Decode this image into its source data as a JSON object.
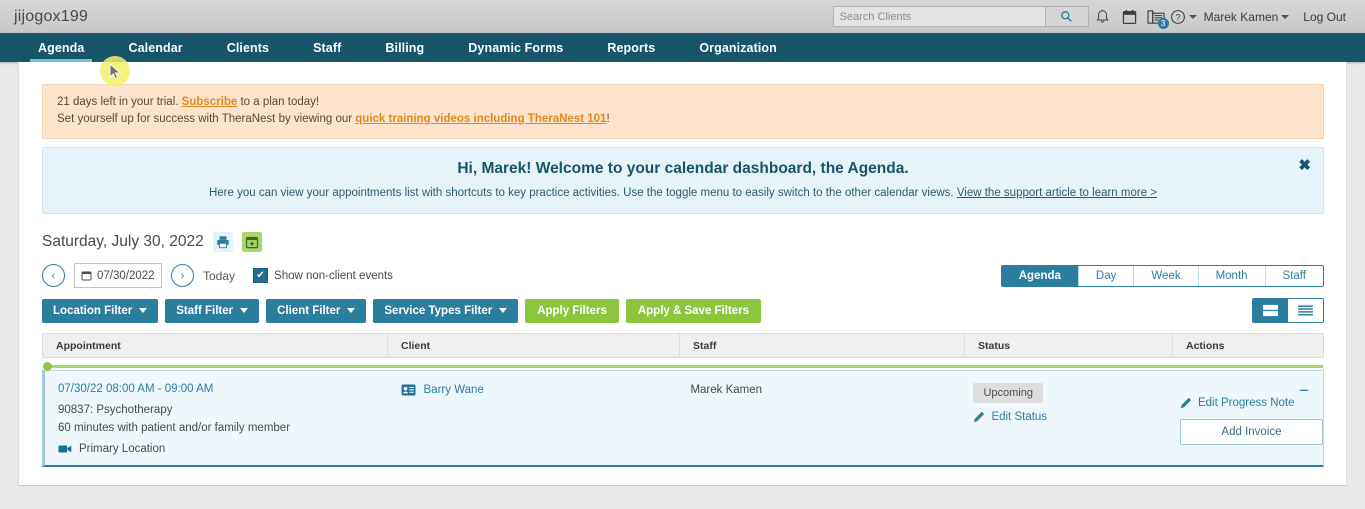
{
  "topbar": {
    "brand": "jijogox199",
    "search_placeholder": "Search Clients",
    "search_value": "",
    "search_icon": "search-icon",
    "bell_icon": "bell-icon",
    "calendar_icon": "calendar-icon",
    "fax_icon": "fax-icon",
    "fax_badge": "3",
    "help_icon": "question-circle-icon",
    "user_name": "Marek Kamen",
    "logout": "Log Out"
  },
  "nav": {
    "items": [
      {
        "label": "Agenda",
        "active": true
      },
      {
        "label": "Calendar",
        "active": false
      },
      {
        "label": "Clients",
        "active": false
      },
      {
        "label": "Staff",
        "active": false
      },
      {
        "label": "Billing",
        "active": false
      },
      {
        "label": "Dynamic Forms",
        "active": false
      },
      {
        "label": "Reports",
        "active": false
      },
      {
        "label": "Organization",
        "active": false
      }
    ]
  },
  "trial_banner": {
    "line1_pre": "21 days left in your trial. ",
    "line1_link": "Subscribe",
    "line1_post": " to a plan today!",
    "line2_pre": "Set yourself up for success with TheraNest by viewing our ",
    "line2_link": "quick training videos including TheraNest 101",
    "line2_post": "!"
  },
  "welcome": {
    "title": "Hi, Marek! Welcome to your calendar dashboard, the Agenda.",
    "body_pre": "Here you can view your appointments list with shortcuts to key practice activities. Use the toggle menu to easily switch to the other calendar views. ",
    "body_link": "View the support article to learn more >",
    "close_icon": "close-icon",
    "close_glyph": "✖"
  },
  "date_row": {
    "title": "Saturday, July 30, 2022",
    "print_icon": "print-icon",
    "add_calendar_icon": "add-calendar-icon"
  },
  "controls": {
    "prev_glyph": "‹",
    "next_glyph": "›",
    "date_value": "07/30/2022",
    "date_icon": "calendar-icon",
    "today_label": "Today",
    "checkbox_checked": true,
    "checkbox_glyph": "✔",
    "checkbox_label": "Show non-client events",
    "views": [
      {
        "label": "Agenda",
        "selected": true
      },
      {
        "label": "Day",
        "selected": false
      },
      {
        "label": "Week",
        "selected": false
      },
      {
        "label": "Month",
        "selected": false
      },
      {
        "label": "Staff",
        "selected": false
      }
    ]
  },
  "filters": {
    "dropdowns": [
      {
        "label": "Location Filter"
      },
      {
        "label": "Staff Filter"
      },
      {
        "label": "Client Filter"
      },
      {
        "label": "Service Types Filter"
      }
    ],
    "apply_label": "Apply Filters",
    "apply_save_label": "Apply & Save Filters",
    "list_view_icon": "card-view-icon",
    "compact_view_icon": "list-view-icon"
  },
  "table": {
    "columns": [
      "Appointment",
      "Client",
      "Staff",
      "Status",
      "Actions"
    ],
    "rows": [
      {
        "time": "07/30/22 08:00 AM - 09:00 AM",
        "service": "90837: Psychotherapy",
        "duration": "60 minutes with patient and/or family member",
        "location": "Primary Location",
        "location_icon": "video-camera-icon",
        "client": "Barry Wane",
        "client_icon": "client-card-icon",
        "staff": "Marek Kamen",
        "status": "Upcoming",
        "edit_status_label": "Edit Status",
        "edit_status_icon": "pencil-icon",
        "edit_note_label": "Edit Progress Note",
        "edit_note_icon": "pencil-icon",
        "add_invoice_label": "Add Invoice",
        "collapse_glyph": "−",
        "collapse_icon": "collapse-icon"
      }
    ]
  },
  "colors": {
    "nav_bg": "#17556b",
    "accent_blue": "#2c7ea1",
    "accent_green": "#8cc63f",
    "trial_bg": "#fbe3cd",
    "welcome_bg": "#e6f4f9"
  },
  "cursor": {
    "icon": "mouse-pointer-icon"
  }
}
